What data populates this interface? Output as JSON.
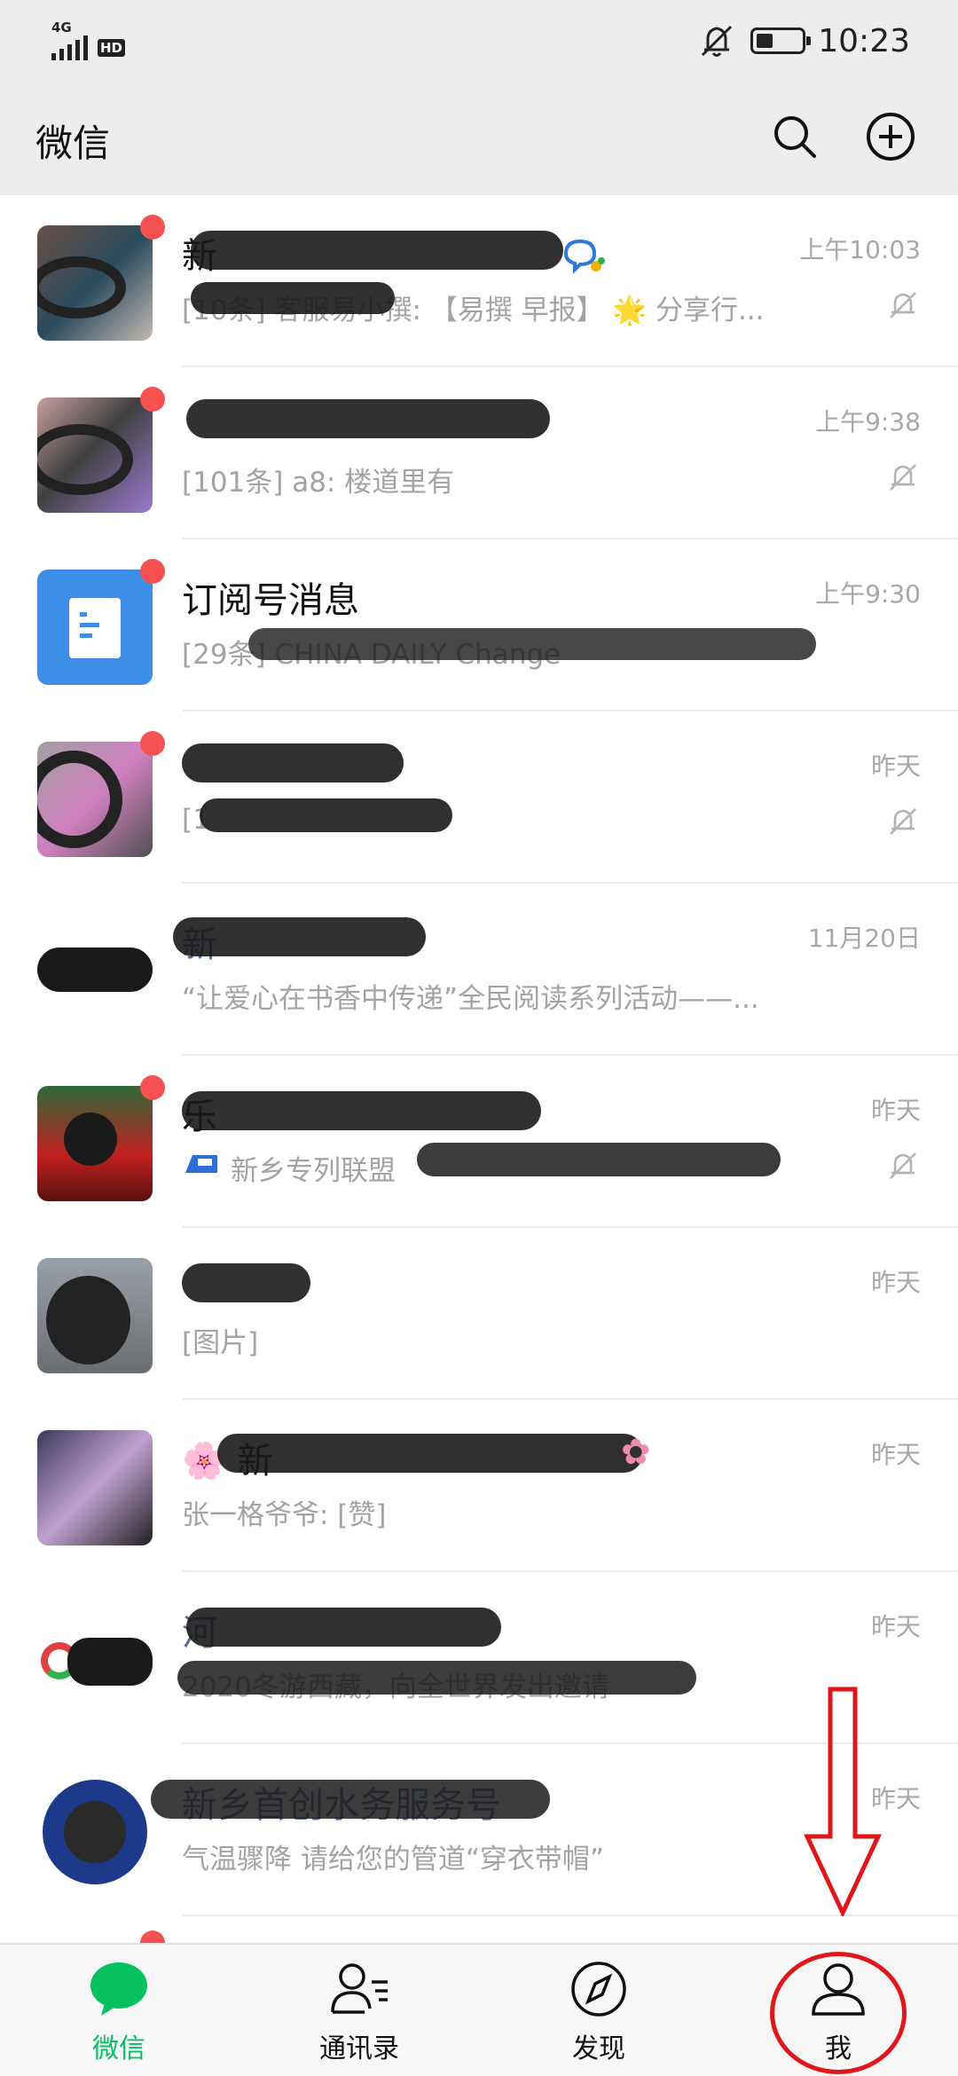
{
  "status_bar": {
    "network": "4G",
    "hd": "HD",
    "time": "10:23"
  },
  "header": {
    "title": "微信"
  },
  "chats": [
    {
      "name": "新",
      "preview": "[10条] 客服易小撰: 【易撰 早报】 🌟 分享行...",
      "time": "上午10:03",
      "muted": true,
      "unread": true,
      "name_color": "dark"
    },
    {
      "name": "",
      "preview": "[101条] a8: 楼道里有",
      "time": "上午9:38",
      "muted": true,
      "unread": true,
      "name_color": "dark"
    },
    {
      "name": "订阅号消息",
      "preview": "[29条] CHINA DAILY Change",
      "time": "上午9:30",
      "muted": false,
      "unread": true,
      "name_color": "dark"
    },
    {
      "name": "",
      "preview": "[1",
      "time": "昨天",
      "muted": true,
      "unread": true,
      "name_color": "dark"
    },
    {
      "name": "新",
      "preview": "“让爱心在书香中传递”全民阅读系列活动——...",
      "time": "11月20日",
      "muted": false,
      "unread": false,
      "name_color": "link"
    },
    {
      "name": "乐",
      "preview": "新乡专列联盟",
      "time": "昨天",
      "muted": true,
      "unread": true,
      "name_color": "dark"
    },
    {
      "name": "",
      "preview": "[图片]",
      "time": "昨天",
      "muted": false,
      "unread": false,
      "name_color": "dark"
    },
    {
      "name": "🌸 新",
      "preview": "张一格爷爷: [赞]",
      "time": "昨天",
      "muted": false,
      "unread": false,
      "name_color": "dark"
    },
    {
      "name": "河",
      "preview": "2020冬游西藏，向全世界发出邀请",
      "time": "昨天",
      "muted": false,
      "unread": false,
      "name_color": "link"
    },
    {
      "name": "新乡首创水务服务号",
      "preview": "气温骤降 请给您的管道“穿衣带帽”",
      "time": "昨天",
      "muted": false,
      "unread": false,
      "name_color": "link"
    }
  ],
  "tabs": [
    {
      "label": "微信",
      "icon": "chat-bubble-icon",
      "active": true
    },
    {
      "label": "通讯录",
      "icon": "contacts-icon",
      "active": false
    },
    {
      "label": "发现",
      "icon": "compass-icon",
      "active": false
    },
    {
      "label": "我",
      "icon": "profile-icon",
      "active": false
    }
  ],
  "colors": {
    "accent": "#07c160",
    "unread": "#f55151",
    "annotation": "#e0161b"
  }
}
